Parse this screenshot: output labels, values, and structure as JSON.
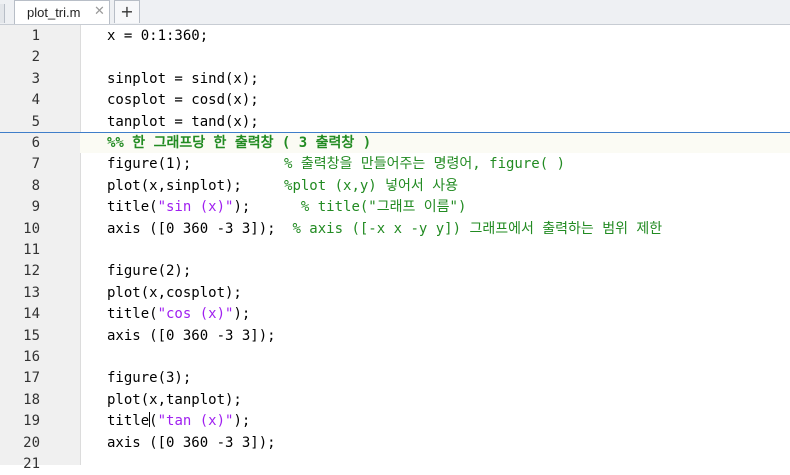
{
  "tab": {
    "filename": "plot_tri.m",
    "close_glyph": "✕",
    "add_glyph": "+"
  },
  "code_lines": [
    {
      "n": "1",
      "code": "x = 0:1:360;"
    },
    {
      "n": "2",
      "code": ""
    },
    {
      "n": "3",
      "code": "sinplot = sind(x);"
    },
    {
      "n": "4",
      "code": "cosplot = cosd(x);"
    },
    {
      "n": "5",
      "code": "tanplot = tand(x);"
    },
    {
      "n": "6",
      "section": "%% 한 그래프당 한 출력창 ( 3 출력창 )"
    },
    {
      "n": "7",
      "code": "figure(1);           ",
      "comment": "% 출력창을 만들어주는 명령어, figure( )"
    },
    {
      "n": "8",
      "code": "plot(x,sinplot);     ",
      "comment": "%plot (x,y) 넣어서 사용"
    },
    {
      "n": "9",
      "pre": "title(",
      "str": "\"sin (x)\"",
      "post": ");      ",
      "comment": "% title(\"그래프 이름\")"
    },
    {
      "n": "10",
      "code": "axis ([0 360 -3 3]);  ",
      "comment": "% axis ([-x x -y y]) 그래프에서 출력하는 범위 제한"
    },
    {
      "n": "11",
      "code": ""
    },
    {
      "n": "12",
      "code": "figure(2);"
    },
    {
      "n": "13",
      "code": "plot(x,cosplot);"
    },
    {
      "n": "14",
      "pre": "title(",
      "str": "\"cos (x)\"",
      "post": ");"
    },
    {
      "n": "15",
      "code": "axis ([0 360 -3 3]);"
    },
    {
      "n": "16",
      "code": ""
    },
    {
      "n": "17",
      "code": "figure(3);"
    },
    {
      "n": "18",
      "code": "plot(x,tanplot);"
    },
    {
      "n": "19",
      "pre": "title",
      "post2": "(",
      "str": "\"tan (x)\"",
      "post": ");",
      "cursor": true
    },
    {
      "n": "20",
      "code": "axis ([0 360 -3 3]);"
    },
    {
      "n": "21",
      "code": ""
    }
  ],
  "colors": {
    "string": "#a020f0",
    "comment": "#228b22",
    "section_rule": "#3f7ec9"
  }
}
